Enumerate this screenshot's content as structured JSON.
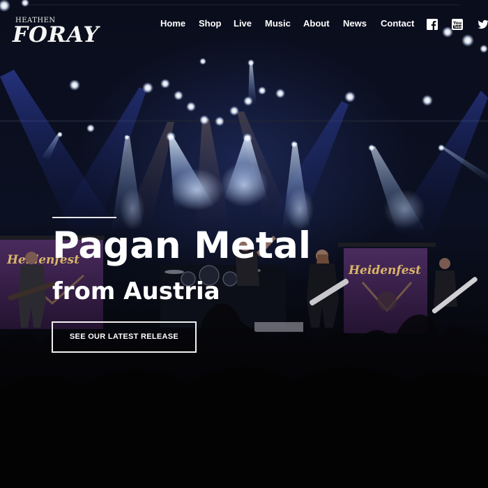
{
  "brand": {
    "logo_small": "HEATHEN",
    "logo_big": "FORAY"
  },
  "nav": {
    "items": [
      {
        "label": "Home"
      },
      {
        "label": "Shop"
      },
      {
        "label": "Live"
      },
      {
        "label": "Music"
      },
      {
        "label": "About"
      },
      {
        "label": "News"
      },
      {
        "label": "Contact"
      }
    ],
    "social": [
      {
        "icon": "facebook-icon"
      },
      {
        "icon": "youtube-icon"
      },
      {
        "icon": "twitter-icon"
      }
    ]
  },
  "hero": {
    "headline": "Pagan Metal",
    "subline": "from Austria",
    "cta_label": "SEE OUR LATEST RELEASE",
    "banner_text": "Heidenfest"
  },
  "colors": {
    "text": "#ffffff",
    "background": "#05060c",
    "stage_light": "#cfe4ff",
    "banner": "#3a1f4a"
  }
}
